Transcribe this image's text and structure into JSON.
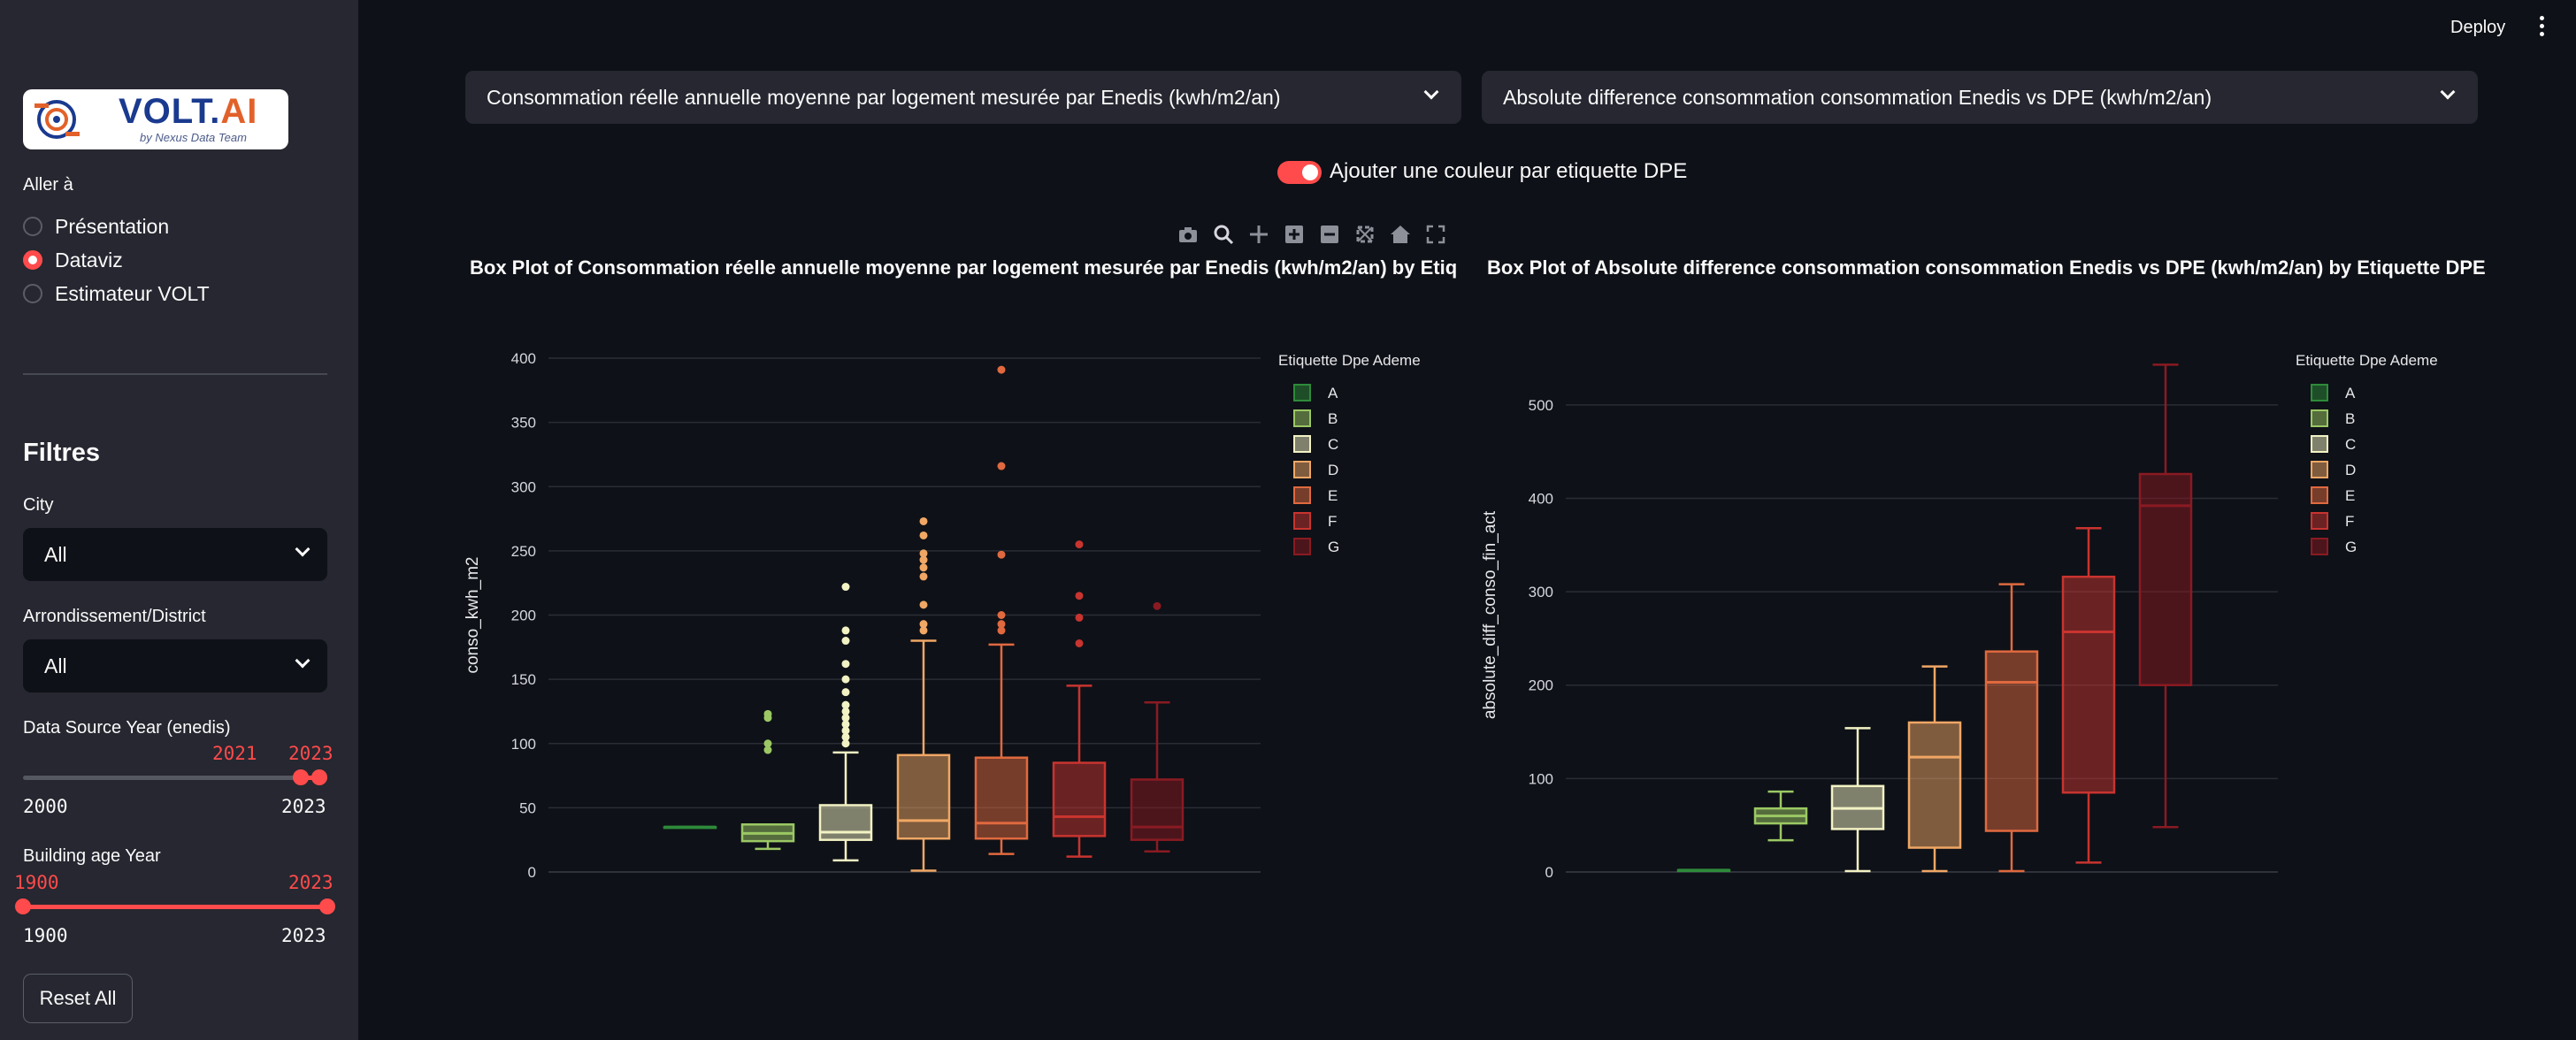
{
  "sidebar": {
    "logo": {
      "brand_main": "VOLT",
      "brand_dot": ".",
      "brand_ai": "AI",
      "tagline": "by Nexus Data Team"
    },
    "nav_label": "Aller à",
    "nav_items": [
      {
        "label": "Présentation",
        "selected": false
      },
      {
        "label": "Dataviz",
        "selected": true
      },
      {
        "label": "Estimateur VOLT",
        "selected": false
      }
    ],
    "filters_title": "Filtres",
    "city": {
      "label": "City",
      "value": "All"
    },
    "district": {
      "label": "Arrondissement/District",
      "value": "All"
    },
    "data_year": {
      "label": "Data Source Year (enedis)",
      "min": "2000",
      "max": "2023",
      "low": "2021",
      "high": "2023"
    },
    "building_year": {
      "label": "Building age Year",
      "min": "1900",
      "max": "2023",
      "low": "1900",
      "high": "2023"
    },
    "reset_label": "Reset All"
  },
  "header": {
    "deploy_label": "Deploy"
  },
  "main": {
    "select_left": "Consommation réelle annuelle moyenne par logement mesurée par Enedis (kwh/m2/an)",
    "select_right": "Absolute difference consommation consommation Enedis vs DPE (kwh/m2/an)",
    "toggle_label": "Ajouter une couleur par etiquette DPE",
    "toggle_on": true,
    "modebar_icons": [
      "camera-icon",
      "zoom-icon",
      "pan-icon",
      "zoom-in-icon",
      "zoom-out-icon",
      "autoscale-icon",
      "home-icon",
      "fullscreen-icon"
    ]
  },
  "chart_data": [
    {
      "type": "box",
      "title": "Box Plot of Consommation réelle annuelle moyenne par logement mesurée par Enedis (kwh/m2/an) by Etiq",
      "ylabel": "conso_kwh_m2",
      "ylim": [
        0,
        400
      ],
      "yticks": [
        0,
        50,
        100,
        150,
        200,
        250,
        300,
        350,
        400
      ],
      "legend_title": "Etiquette Dpe Ademe",
      "legend_position": "right",
      "grid": true,
      "categories": [
        "A",
        "B",
        "C",
        "D",
        "E",
        "F",
        "G"
      ],
      "colors": [
        "#2e8b3a",
        "#9bc864",
        "#f2f2c4",
        "#f0a765",
        "#e0693f",
        "#c8342f",
        "#8a1a22"
      ],
      "boxes": [
        {
          "name": "A",
          "min": 35,
          "q1": 35,
          "median": 35,
          "q3": 35,
          "max": 35,
          "outliers": []
        },
        {
          "name": "B",
          "min": 18,
          "q1": 24,
          "median": 30,
          "q3": 37,
          "max": 37,
          "outliers": [
            95,
            100,
            120,
            123
          ]
        },
        {
          "name": "C",
          "min": 9,
          "q1": 25,
          "median": 31,
          "q3": 52,
          "max": 93,
          "outliers": [
            100,
            105,
            110,
            115,
            120,
            125,
            130,
            140,
            150,
            162,
            180,
            188,
            222
          ]
        },
        {
          "name": "D",
          "min": 1,
          "q1": 26,
          "median": 40,
          "q3": 91,
          "max": 180,
          "outliers": [
            188,
            193,
            208,
            230,
            237,
            243,
            248,
            262,
            273
          ]
        },
        {
          "name": "E",
          "min": 14,
          "q1": 26,
          "median": 38,
          "q3": 89,
          "max": 177,
          "outliers": [
            188,
            193,
            200,
            247,
            316,
            391
          ]
        },
        {
          "name": "F",
          "min": 12,
          "q1": 28,
          "median": 43,
          "q3": 85,
          "max": 145,
          "outliers": [
            178,
            198,
            215,
            255
          ]
        },
        {
          "name": "G",
          "min": 16,
          "q1": 25,
          "median": 35,
          "q3": 72,
          "max": 132,
          "outliers": [
            207
          ]
        }
      ]
    },
    {
      "type": "box",
      "title": "Box Plot of Absolute difference consommation consommation Enedis vs DPE (kwh/m2/an) by Etiquette DPE",
      "ylabel": "absolute_diff_conso_fin_act",
      "ylim": [
        0,
        550
      ],
      "yticks": [
        0,
        100,
        200,
        300,
        400,
        500
      ],
      "legend_title": "Etiquette Dpe Ademe",
      "legend_position": "right",
      "grid": true,
      "categories": [
        "A",
        "B",
        "C",
        "D",
        "E",
        "F",
        "G"
      ],
      "colors": [
        "#2e8b3a",
        "#9bc864",
        "#f2f2c4",
        "#f0a765",
        "#e0693f",
        "#c8342f",
        "#8a1a22"
      ],
      "boxes": [
        {
          "name": "A",
          "min": 2,
          "q1": 2,
          "median": 2,
          "q3": 2,
          "max": 2,
          "outliers": []
        },
        {
          "name": "B",
          "min": 34,
          "q1": 52,
          "median": 60,
          "q3": 68,
          "max": 86,
          "outliers": []
        },
        {
          "name": "C",
          "min": 1,
          "q1": 46,
          "median": 68,
          "q3": 92,
          "max": 154,
          "outliers": []
        },
        {
          "name": "D",
          "min": 1,
          "q1": 26,
          "median": 123,
          "q3": 160,
          "max": 220,
          "outliers": []
        },
        {
          "name": "E",
          "min": 1,
          "q1": 44,
          "median": 203,
          "q3": 236,
          "max": 308,
          "outliers": []
        },
        {
          "name": "F",
          "min": 10,
          "q1": 85,
          "median": 257,
          "q3": 316,
          "max": 368,
          "outliers": []
        },
        {
          "name": "G",
          "min": 48,
          "q1": 200,
          "median": 392,
          "q3": 426,
          "max": 543,
          "outliers": []
        }
      ]
    }
  ]
}
